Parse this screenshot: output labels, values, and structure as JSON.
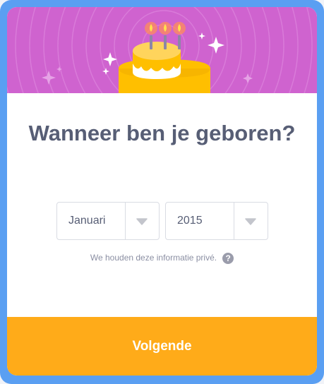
{
  "dialog": {
    "title": "Wanneer ben je geboren?"
  },
  "birth_month": {
    "value": "Januari",
    "caret_icon": "caret-down-icon"
  },
  "birth_year": {
    "value": "2015",
    "caret_icon": "caret-down-icon"
  },
  "privacy": {
    "text": "We houden deze informatie privé.",
    "help_icon": "question-mark",
    "help_glyph": "?"
  },
  "footer": {
    "next_label": "Volgende"
  },
  "colors": {
    "frame": "#5a9ff2",
    "banner": "#cf63cf",
    "title_text": "#575e75",
    "next_button": "#ffab19",
    "cake": "#ffbf00",
    "cake_dark": "#e8a200"
  }
}
